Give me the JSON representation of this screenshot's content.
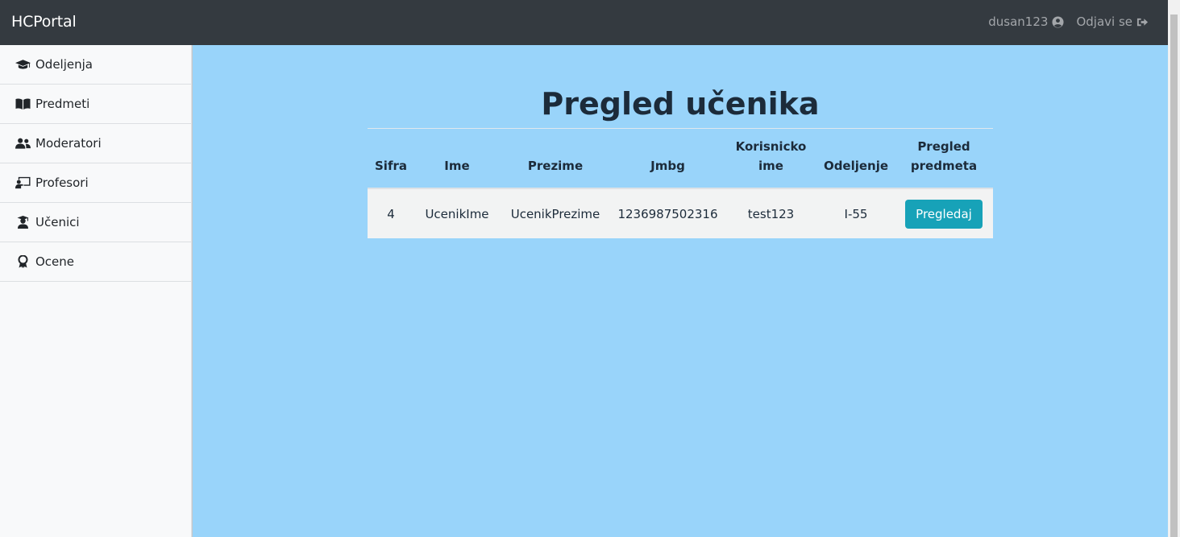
{
  "app": {
    "brand": "HCPortal"
  },
  "header": {
    "user_label": "dusan123",
    "user_icon": "user-circle-icon",
    "logout_label": "Odjavi se",
    "logout_icon": "sign-out-icon"
  },
  "sidebar": {
    "items": [
      {
        "label": "Odeljenja",
        "icon": "graduation-cap-icon"
      },
      {
        "label": "Predmeti",
        "icon": "book-open-icon"
      },
      {
        "label": "Moderatori",
        "icon": "users-icon"
      },
      {
        "label": "Profesori",
        "icon": "chalkboard-teacher-icon"
      },
      {
        "label": "Učenici",
        "icon": "user-graduate-icon"
      },
      {
        "label": "Ocene",
        "icon": "award-icon"
      }
    ]
  },
  "main": {
    "title": "Pregled učenika",
    "table": {
      "columns": [
        "Sifra",
        "Ime",
        "Prezime",
        "Jmbg",
        "Korisnicko ime",
        "Odeljenje",
        "Pregled predmeta"
      ],
      "rows": [
        {
          "sifra": "4",
          "ime": "UcenikIme",
          "prezime": "UcenikPrezime",
          "jmbg": "1236987502316",
          "korisnicko_ime": "test123",
          "odeljenje": "I-55",
          "action_label": "Pregledaj"
        }
      ]
    }
  },
  "colors": {
    "navbar": "#343a40",
    "sidebar": "#f8f9fa",
    "main_background": "#99d4fa",
    "button": "#17a2b8"
  }
}
